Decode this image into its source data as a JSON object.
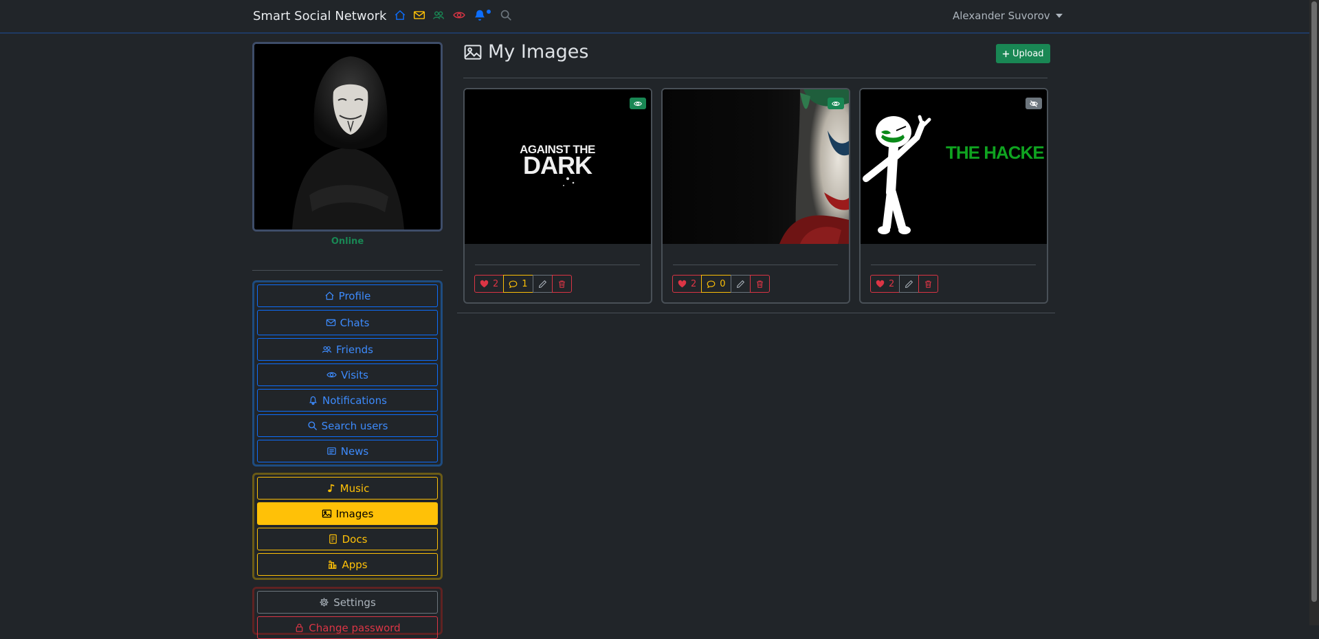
{
  "navbar": {
    "brand": "Smart Social Network",
    "icons": [
      "home-icon",
      "envelope-icon",
      "people-icon",
      "eye-icon",
      "bell-icon",
      "search-icon"
    ],
    "notification_indicator": true,
    "user_name": "Alexander Suvorov"
  },
  "profile": {
    "status": "Online"
  },
  "sidebar": {
    "nav": [
      {
        "label": "Profile",
        "icon": "house-icon"
      },
      {
        "label": "Chats",
        "icon": "envelope-icon"
      },
      {
        "label": "Friends",
        "icon": "people-icon"
      },
      {
        "label": "Visits",
        "icon": "eye-icon"
      },
      {
        "label": "Notifications",
        "icon": "bell-icon"
      },
      {
        "label": "Search users",
        "icon": "search-icon"
      },
      {
        "label": "News",
        "icon": "newspaper-icon"
      }
    ],
    "media": [
      {
        "label": "Music",
        "icon": "music-note-icon"
      },
      {
        "label": "Images",
        "icon": "image-icon",
        "active": true
      },
      {
        "label": "Docs",
        "icon": "file-icon"
      },
      {
        "label": "Apps",
        "icon": "apps-icon"
      }
    ],
    "account": [
      {
        "label": "Settings",
        "icon": "gear-icon"
      },
      {
        "label": "Change password",
        "icon": "lock-icon"
      }
    ]
  },
  "main": {
    "title": "My Images",
    "upload_label": "Upload",
    "images": [
      {
        "caption_text": "AGAINST THE DARK",
        "visibility": "public",
        "likes": "2",
        "comments": "1"
      },
      {
        "caption_text": "",
        "visibility": "public",
        "likes": "2",
        "comments": "0"
      },
      {
        "caption_text": "THE HACKE",
        "visibility": "hidden",
        "likes": "2",
        "comments": null
      }
    ]
  },
  "colors": {
    "background": "#212529",
    "primary": "#0d6efd",
    "warning": "#ffc107",
    "danger": "#dc3545",
    "success": "#198754"
  }
}
